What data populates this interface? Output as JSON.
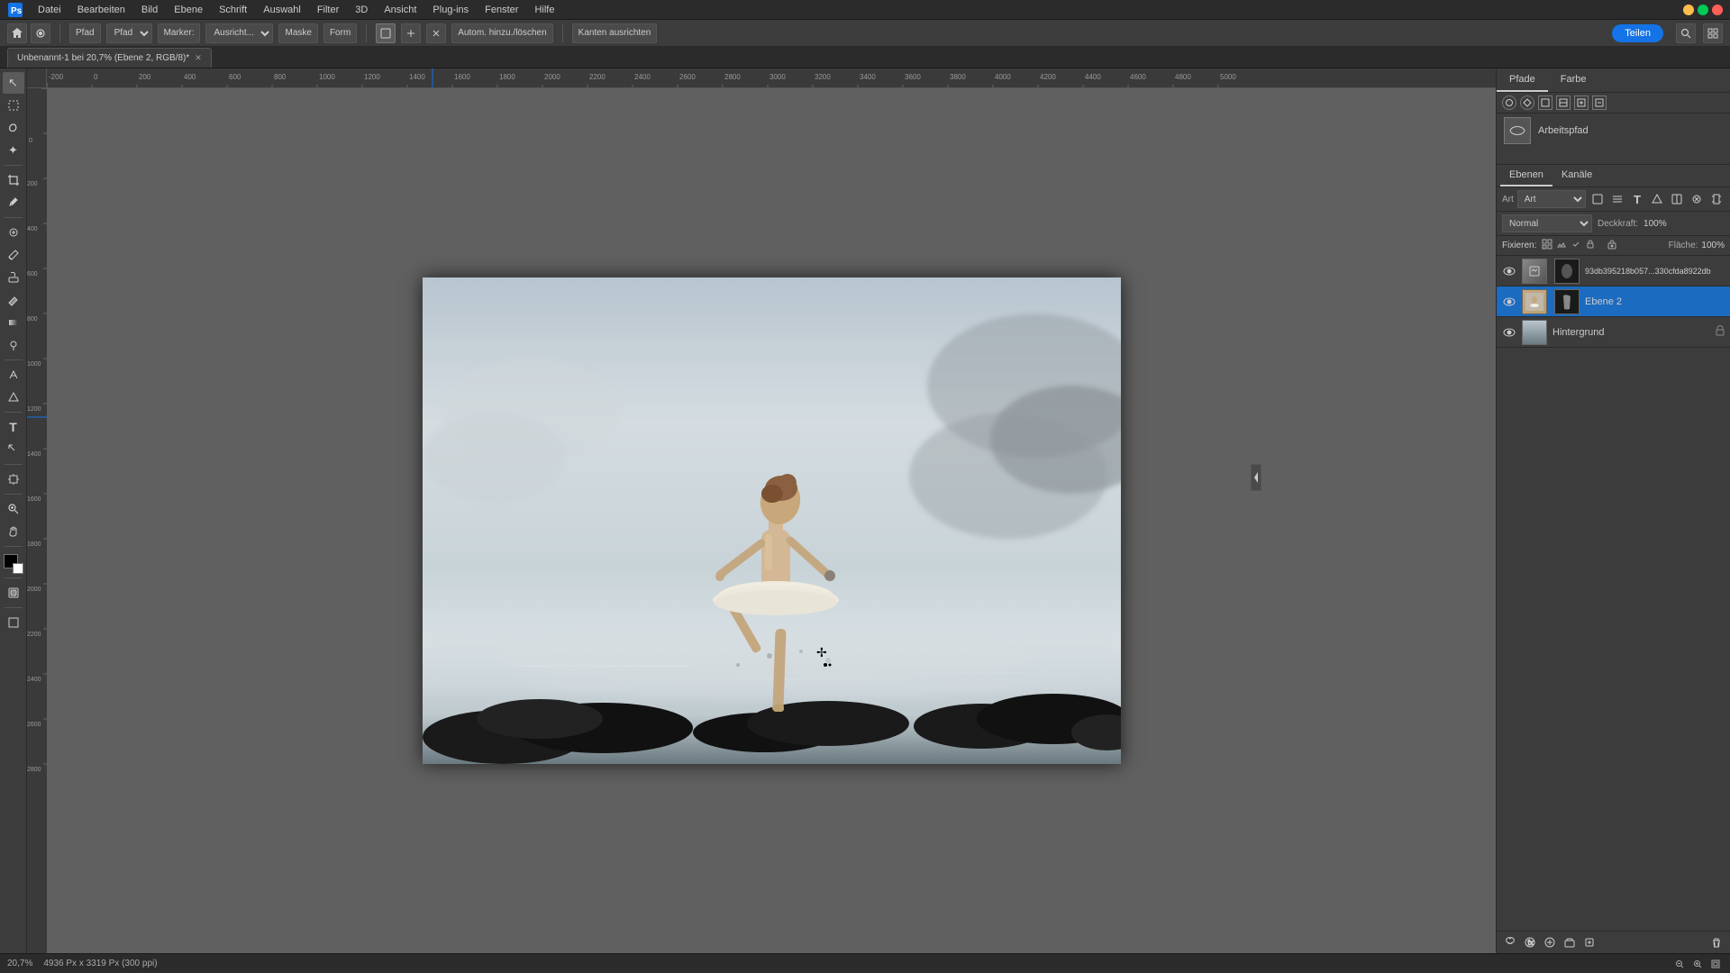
{
  "menu": {
    "items": [
      "Datei",
      "Bearbeiten",
      "Bild",
      "Ebene",
      "Schrift",
      "Auswahl",
      "Filter",
      "3D",
      "Ansicht",
      "Plug-ins",
      "Fenster",
      "Hilfe"
    ]
  },
  "toolbar": {
    "pfad_label": "Pfad",
    "marker_label": "Marker:",
    "ausrichten_label": "Ausricht...",
    "maske_label": "Maske",
    "form_label": "Form",
    "autom_label": "Autom. hinzu./löschen",
    "kanten_label": "Kanten ausrichten",
    "share_label": "Teilen"
  },
  "tab": {
    "title": "Unbenannt-1 bei 20,7% (Ebene 2, RGB/8)*",
    "close": "✕"
  },
  "canvas": {
    "zoom": "20,7%",
    "dimensions": "4936 Px x 3319 Px (300 ppi)"
  },
  "paths_panel": {
    "tabs": [
      "Pfade",
      "Farbe"
    ],
    "active_tab": "Pfade",
    "items": [
      {
        "name": "Arbeitspfad"
      }
    ],
    "icon_buttons": [
      "○",
      "◇",
      "□",
      "□",
      "□",
      "□"
    ]
  },
  "layers_panel": {
    "tabs": [
      "Ebenen",
      "Kanäle"
    ],
    "active_tab": "Ebenen",
    "blend_mode": "Normal",
    "opacity_label": "Deckkraft:",
    "opacity_value": "100%",
    "fill_label": "Fläche:",
    "fill_value": "100%",
    "lock_label": "Fixieren:",
    "layers": [
      {
        "name": "93db395218b057...330cfda8922db",
        "visible": true,
        "selected": false,
        "has_mask": true,
        "type": "smart"
      },
      {
        "name": "Ebene 2",
        "visible": true,
        "selected": true,
        "has_mask": true,
        "type": "normal"
      },
      {
        "name": "Hintergrund",
        "visible": true,
        "selected": false,
        "has_mask": false,
        "type": "background",
        "locked": true
      }
    ]
  },
  "tools": [
    {
      "icon": "↖",
      "name": "move-tool"
    },
    {
      "icon": "◻",
      "name": "selection-tool"
    },
    {
      "icon": "⊙",
      "name": "lasso-tool"
    },
    {
      "icon": "✦",
      "name": "magic-wand-tool"
    },
    {
      "icon": "✂",
      "name": "crop-tool"
    },
    {
      "icon": "⊕",
      "name": "eyedropper-tool"
    },
    {
      "icon": "◈",
      "name": "spot-healing-tool"
    },
    {
      "icon": "✏",
      "name": "brush-tool"
    },
    {
      "icon": "♦",
      "name": "clone-stamp-tool"
    },
    {
      "icon": "⊘",
      "name": "eraser-tool"
    },
    {
      "icon": "▓",
      "name": "gradient-tool"
    },
    {
      "icon": "◉",
      "name": "dodge-tool"
    },
    {
      "icon": "⊗",
      "name": "pen-tool"
    },
    {
      "icon": "Δ",
      "name": "shape-tool"
    },
    {
      "icon": "T",
      "name": "text-tool"
    },
    {
      "icon": "⊡",
      "name": "path-selection-tool"
    },
    {
      "icon": "⊞",
      "name": "artboard-tool"
    },
    {
      "icon": "🔍",
      "name": "zoom-tool"
    },
    {
      "icon": "✋",
      "name": "hand-tool"
    }
  ],
  "status": {
    "zoom": "20,7%",
    "dimensions": "4936 Px x 3319 Px (300 ppi)"
  }
}
